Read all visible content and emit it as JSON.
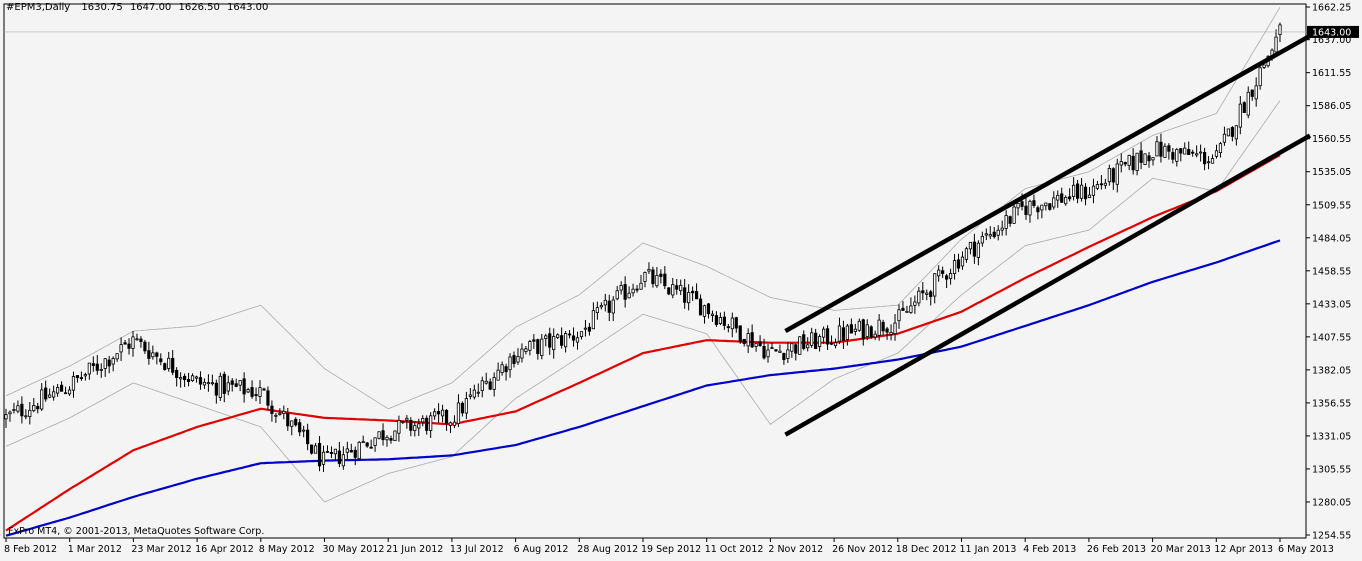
{
  "header": {
    "symbol": "#EPM3,Daily",
    "open": "1630.75",
    "high": "1647.00",
    "low": "1626.50",
    "close": "1643.00"
  },
  "copyright": "FxPro MT4, © 2001-2013, MetaQuotes Software Corp.",
  "chart_data": {
    "type": "candlestick",
    "price_axis": {
      "ticks": [
        "1662.25",
        "1637.00",
        "1611.55",
        "1586.05",
        "1560.55",
        "1535.05",
        "1509.55",
        "1484.05",
        "1458.55",
        "1433.05",
        "1407.55",
        "1382.05",
        "1356.55",
        "1331.05",
        "1305.55",
        "1280.05",
        "1254.55"
      ],
      "ylim": [
        1254.55,
        1662.25
      ],
      "current_price_label": "1643.00",
      "current_price": 1643.0
    },
    "time_axis": {
      "labels": [
        "8 Feb 2012",
        "1 Mar 2012",
        "23 Mar 2012",
        "16 Apr 2012",
        "8 May 2012",
        "30 May 2012",
        "21 Jun 2012",
        "13 Jul 2012",
        "6 Aug 2012",
        "28 Aug 2012",
        "19 Sep 2012",
        "11 Oct 2012",
        "2 Nov 2012",
        "26 Nov 2012",
        "18 Dec 2012",
        "11 Jan 2013",
        "4 Feb 2013",
        "26 Feb 2013",
        "20 Mar 2013",
        "12 Apr 2013",
        "6 May 2013"
      ]
    },
    "price_path": [
      {
        "label": "8 Feb 2012",
        "close": 1345
      },
      {
        "label": "1 Mar 2012",
        "close": 1370
      },
      {
        "label": "23 Mar 2012",
        "close": 1405
      },
      {
        "label": "16 Apr 2012",
        "close": 1372
      },
      {
        "label": "8 May 2012",
        "close": 1365
      },
      {
        "label": "30 May 2012",
        "close": 1310
      },
      {
        "label": "21 Jun 2012",
        "close": 1335
      },
      {
        "label": "13 Jul 2012",
        "close": 1345
      },
      {
        "label": "6 Aug 2012",
        "close": 1395
      },
      {
        "label": "28 Aug 2012",
        "close": 1410
      },
      {
        "label": "19 Sep 2012",
        "close": 1455
      },
      {
        "label": "11 Oct 2012",
        "close": 1430
      },
      {
        "label": "2 Nov 2012",
        "close": 1395
      },
      {
        "label": "26 Nov 2012",
        "close": 1408
      },
      {
        "label": "18 Dec 2012",
        "close": 1420
      },
      {
        "label": "11 Jan 2013",
        "close": 1470
      },
      {
        "label": "4 Feb 2013",
        "close": 1508
      },
      {
        "label": "26 Feb 2013",
        "close": 1520
      },
      {
        "label": "20 Mar 2013",
        "close": 1552
      },
      {
        "label": "12 Apr 2013",
        "close": 1545
      },
      {
        "label": "6 May 2013",
        "close": 1643
      }
    ],
    "series": [
      {
        "kind": "moving_average",
        "color": "#e00000",
        "values": [
          1258,
          1290,
          1320,
          1338,
          1352,
          1345,
          1343,
          1340,
          1350,
          1372,
          1395,
          1405,
          1403,
          1403,
          1410,
          1427,
          1453,
          1477,
          1500,
          1520,
          1548
        ]
      },
      {
        "kind": "moving_average",
        "color": "#0000cc",
        "values": [
          1254,
          1268,
          1284,
          1298,
          1310,
          1312,
          1313,
          1316,
          1324,
          1338,
          1354,
          1370,
          1378,
          1383,
          1390,
          1400,
          1416,
          1432,
          1450,
          1465,
          1482
        ]
      },
      {
        "kind": "bollinger_upper",
        "color": "#aaaaaa",
        "values": [
          1362,
          1385,
          1412,
          1416,
          1432,
          1383,
          1352,
          1372,
          1415,
          1440,
          1480,
          1462,
          1438,
          1428,
          1432,
          1483,
          1522,
          1535,
          1563,
          1580,
          1662
        ]
      },
      {
        "kind": "bollinger_lower",
        "color": "#aaaaaa",
        "values": [
          1323,
          1345,
          1372,
          1355,
          1338,
          1280,
          1302,
          1315,
          1360,
          1392,
          1425,
          1410,
          1340,
          1375,
          1395,
          1440,
          1478,
          1490,
          1530,
          1520,
          1590
        ]
      }
    ],
    "trendlines": [
      {
        "color": "#000000",
        "from": {
          "label": "2 Nov 2012",
          "price": 1412
        },
        "to": {
          "label": "6 May 2013",
          "price": 1640
        }
      },
      {
        "color": "#000000",
        "from": {
          "label": "2 Nov 2012",
          "price": 1332
        },
        "to": {
          "label": "6 May 2013",
          "price": 1563
        }
      }
    ],
    "grid": false
  }
}
